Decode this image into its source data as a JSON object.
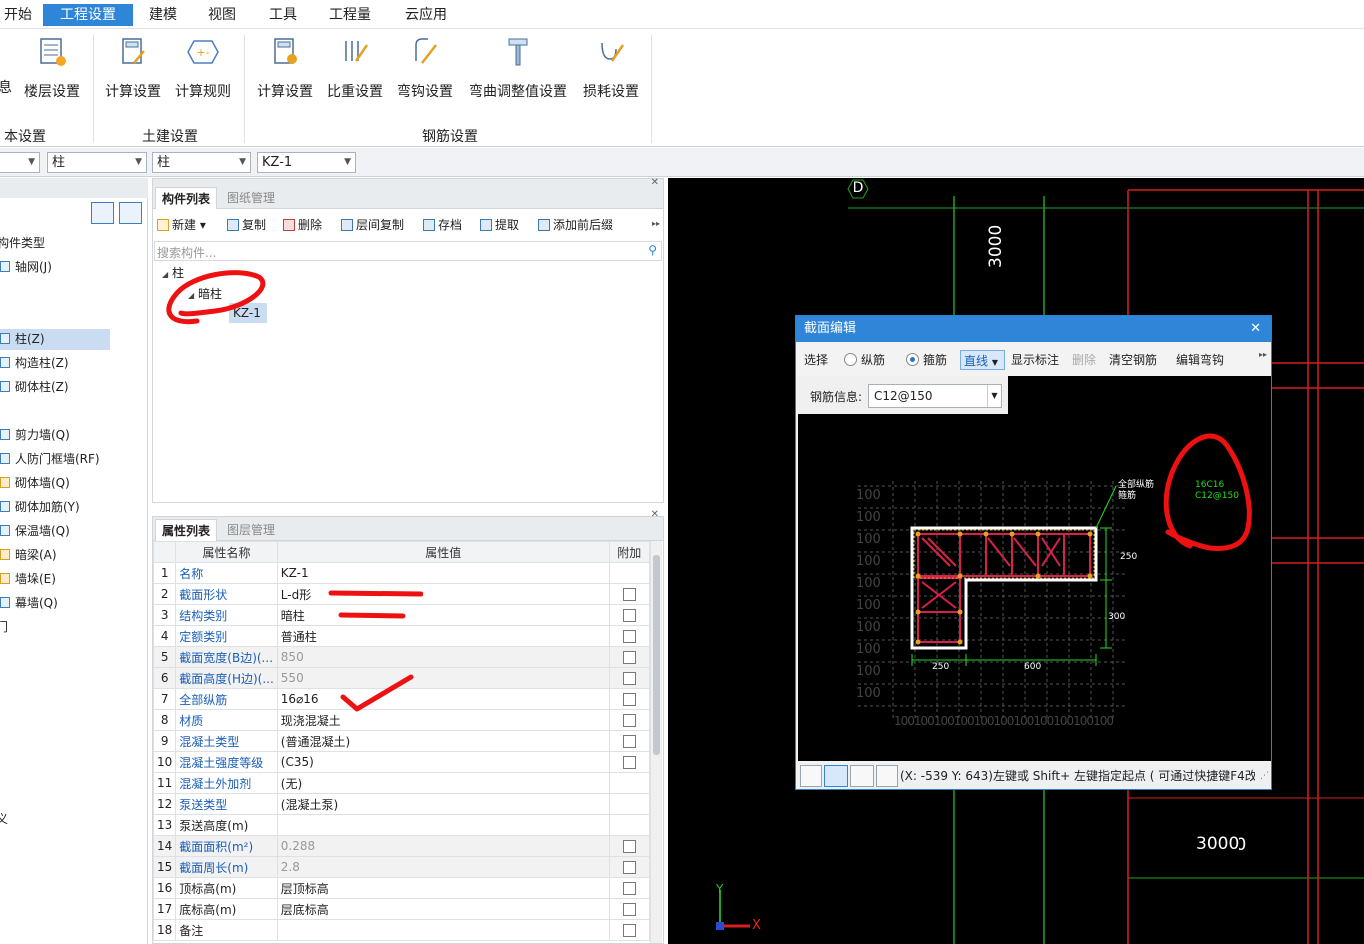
{
  "menu": {
    "items": [
      "开始",
      "工程设置",
      "建模",
      "视图",
      "工具",
      "工程量",
      "云应用"
    ],
    "active": "工程设置"
  },
  "ribbon": {
    "basic": {
      "b1": "息",
      "b2": "楼层设置",
      "group": "本设置"
    },
    "civil": {
      "b1": "计算设置",
      "b2": "计算规则",
      "group": "土建设置"
    },
    "rebar": {
      "b1": "计算设置",
      "b2": "比重设置",
      "b3": "弯钩设置",
      "b4": "弯曲调整值设置",
      "b5": "损耗设置",
      "group": "钢筋设置"
    }
  },
  "filter": {
    "combo2": "柱",
    "combo3": "柱",
    "combo4": "KZ-1"
  },
  "leftnav": {
    "header": "构件类型",
    "items": [
      "轴网(J)",
      "柱(Z)",
      "构造柱(Z)",
      "砌体柱(Z)",
      "剪力墙(Q)",
      "人防门框墙(RF)",
      "砌体墙(Q)",
      "砌体加筋(Y)",
      "保温墙(Q)",
      "暗梁(A)",
      "墙垛(E)",
      "幕墙(Q)",
      "门",
      "义"
    ]
  },
  "component_panel": {
    "tab_active": "构件列表",
    "tab_other": "图纸管理",
    "toolbar": {
      "new": "新建",
      "copy": "复制",
      "delete": "删除",
      "floor_copy": "层间复制",
      "save": "存档",
      "extract": "提取",
      "add_prefix": "添加前后缀"
    },
    "search_placeholder": "搜索构件...",
    "tree": {
      "root": "柱",
      "child": "暗柱",
      "leaf": "KZ-1"
    }
  },
  "props_panel": {
    "tab_active": "属性列表",
    "tab_other": "图层管理",
    "headers": {
      "name": "属性名称",
      "value": "属性值",
      "extra": "附加"
    },
    "rows": [
      {
        "n": "1",
        "name": "名称",
        "value": "KZ-1",
        "blue": true,
        "gray": false,
        "cb": false
      },
      {
        "n": "2",
        "name": "截面形状",
        "value": "L-d形",
        "blue": true,
        "gray": false,
        "cb": true
      },
      {
        "n": "3",
        "name": "结构类别",
        "value": "暗柱",
        "blue": true,
        "gray": false,
        "cb": true
      },
      {
        "n": "4",
        "name": "定额类别",
        "value": "普通柱",
        "blue": true,
        "gray": false,
        "cb": true
      },
      {
        "n": "5",
        "name": "截面宽度(B边)(...",
        "value": "850",
        "blue": true,
        "gray": true,
        "cb": true
      },
      {
        "n": "6",
        "name": "截面高度(H边)(...",
        "value": "550",
        "blue": true,
        "gray": true,
        "cb": true
      },
      {
        "n": "7",
        "name": "全部纵筋",
        "value": "16⌀16",
        "blue": true,
        "gray": false,
        "cb": true
      },
      {
        "n": "8",
        "name": "材质",
        "value": "现浇混凝土",
        "blue": true,
        "gray": false,
        "cb": true
      },
      {
        "n": "9",
        "name": "混凝土类型",
        "value": "(普通混凝土)",
        "blue": true,
        "gray": false,
        "cb": true
      },
      {
        "n": "10",
        "name": "混凝土强度等级",
        "value": "(C35)",
        "blue": true,
        "gray": false,
        "cb": true
      },
      {
        "n": "11",
        "name": "混凝土外加剂",
        "value": "(无)",
        "blue": true,
        "gray": false,
        "cb": false
      },
      {
        "n": "12",
        "name": "泵送类型",
        "value": "(混凝土泵)",
        "blue": true,
        "gray": false,
        "cb": false
      },
      {
        "n": "13",
        "name": "泵送高度(m)",
        "value": "",
        "blue": false,
        "gray": false,
        "cb": false
      },
      {
        "n": "14",
        "name": "截面面积(m²)",
        "value": "0.288",
        "blue": true,
        "gray": true,
        "cb": true
      },
      {
        "n": "15",
        "name": "截面周长(m)",
        "value": "2.8",
        "blue": true,
        "gray": true,
        "cb": true
      },
      {
        "n": "16",
        "name": "顶标高(m)",
        "value": "层顶标高",
        "blue": false,
        "gray": false,
        "cb": true
      },
      {
        "n": "17",
        "name": "底标高(m)",
        "value": "层底标高",
        "blue": false,
        "gray": false,
        "cb": true
      },
      {
        "n": "18",
        "name": "备注",
        "value": "",
        "blue": false,
        "gray": false,
        "cb": true
      }
    ]
  },
  "canvas": {
    "axis_label": "D",
    "dim_top": "3000",
    "dim_bottom": "3000",
    "x_axis": "X",
    "y_axis": "Y"
  },
  "dialog": {
    "title": "截面编辑",
    "toolbar": {
      "select": "选择",
      "longitudinal": "纵筋",
      "stirrup": "箍筋",
      "line": "直线",
      "show_dim": "显示标注",
      "delete": "删除",
      "clear": "清空钢筋",
      "edit_hook": "编辑弯钩"
    },
    "rebar_info_label": "钢筋信息:",
    "rebar_info_value": "C12@150",
    "grid_labels": [
      "100",
      "100",
      "100",
      "100",
      "100",
      "100",
      "100",
      "100",
      "100",
      "100"
    ],
    "bottom_labels": [
      "100",
      "100",
      "100",
      "100",
      "100",
      "100",
      "100",
      "100",
      "100",
      "100",
      "100"
    ],
    "dims": {
      "d1": "250",
      "d2": "300",
      "d3": "250",
      "d4": "600"
    },
    "legend": {
      "l1": "全部纵筋",
      "l2": "箍筋",
      "v1": "16C16",
      "v2": "C12@150"
    },
    "status": "(X: -539 Y: 643)左键或 Shift+ 左键指定起点 ( 可通过快捷键F4改"
  }
}
